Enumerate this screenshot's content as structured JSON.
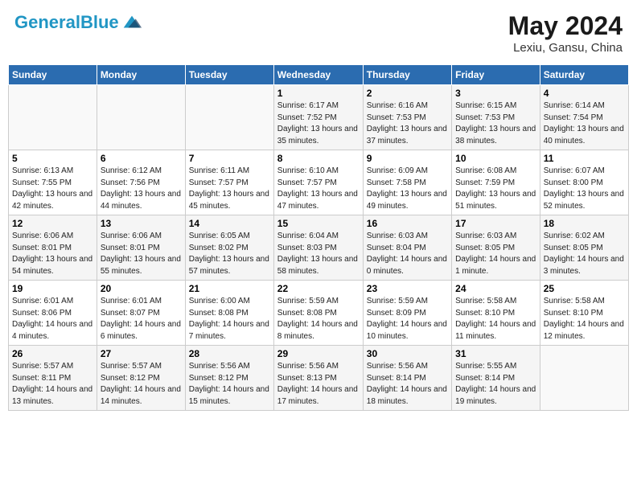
{
  "header": {
    "logo_text_general": "General",
    "logo_text_blue": "Blue",
    "month_year": "May 2024",
    "location": "Lexiu, Gansu, China"
  },
  "days_of_week": [
    "Sunday",
    "Monday",
    "Tuesday",
    "Wednesday",
    "Thursday",
    "Friday",
    "Saturday"
  ],
  "weeks": [
    [
      {
        "day": "",
        "sunrise": "",
        "sunset": "",
        "daylight": ""
      },
      {
        "day": "",
        "sunrise": "",
        "sunset": "",
        "daylight": ""
      },
      {
        "day": "",
        "sunrise": "",
        "sunset": "",
        "daylight": ""
      },
      {
        "day": "1",
        "sunrise": "Sunrise: 6:17 AM",
        "sunset": "Sunset: 7:52 PM",
        "daylight": "Daylight: 13 hours and 35 minutes."
      },
      {
        "day": "2",
        "sunrise": "Sunrise: 6:16 AM",
        "sunset": "Sunset: 7:53 PM",
        "daylight": "Daylight: 13 hours and 37 minutes."
      },
      {
        "day": "3",
        "sunrise": "Sunrise: 6:15 AM",
        "sunset": "Sunset: 7:53 PM",
        "daylight": "Daylight: 13 hours and 38 minutes."
      },
      {
        "day": "4",
        "sunrise": "Sunrise: 6:14 AM",
        "sunset": "Sunset: 7:54 PM",
        "daylight": "Daylight: 13 hours and 40 minutes."
      }
    ],
    [
      {
        "day": "5",
        "sunrise": "Sunrise: 6:13 AM",
        "sunset": "Sunset: 7:55 PM",
        "daylight": "Daylight: 13 hours and 42 minutes."
      },
      {
        "day": "6",
        "sunrise": "Sunrise: 6:12 AM",
        "sunset": "Sunset: 7:56 PM",
        "daylight": "Daylight: 13 hours and 44 minutes."
      },
      {
        "day": "7",
        "sunrise": "Sunrise: 6:11 AM",
        "sunset": "Sunset: 7:57 PM",
        "daylight": "Daylight: 13 hours and 45 minutes."
      },
      {
        "day": "8",
        "sunrise": "Sunrise: 6:10 AM",
        "sunset": "Sunset: 7:57 PM",
        "daylight": "Daylight: 13 hours and 47 minutes."
      },
      {
        "day": "9",
        "sunrise": "Sunrise: 6:09 AM",
        "sunset": "Sunset: 7:58 PM",
        "daylight": "Daylight: 13 hours and 49 minutes."
      },
      {
        "day": "10",
        "sunrise": "Sunrise: 6:08 AM",
        "sunset": "Sunset: 7:59 PM",
        "daylight": "Daylight: 13 hours and 51 minutes."
      },
      {
        "day": "11",
        "sunrise": "Sunrise: 6:07 AM",
        "sunset": "Sunset: 8:00 PM",
        "daylight": "Daylight: 13 hours and 52 minutes."
      }
    ],
    [
      {
        "day": "12",
        "sunrise": "Sunrise: 6:06 AM",
        "sunset": "Sunset: 8:01 PM",
        "daylight": "Daylight: 13 hours and 54 minutes."
      },
      {
        "day": "13",
        "sunrise": "Sunrise: 6:06 AM",
        "sunset": "Sunset: 8:01 PM",
        "daylight": "Daylight: 13 hours and 55 minutes."
      },
      {
        "day": "14",
        "sunrise": "Sunrise: 6:05 AM",
        "sunset": "Sunset: 8:02 PM",
        "daylight": "Daylight: 13 hours and 57 minutes."
      },
      {
        "day": "15",
        "sunrise": "Sunrise: 6:04 AM",
        "sunset": "Sunset: 8:03 PM",
        "daylight": "Daylight: 13 hours and 58 minutes."
      },
      {
        "day": "16",
        "sunrise": "Sunrise: 6:03 AM",
        "sunset": "Sunset: 8:04 PM",
        "daylight": "Daylight: 14 hours and 0 minutes."
      },
      {
        "day": "17",
        "sunrise": "Sunrise: 6:03 AM",
        "sunset": "Sunset: 8:05 PM",
        "daylight": "Daylight: 14 hours and 1 minute."
      },
      {
        "day": "18",
        "sunrise": "Sunrise: 6:02 AM",
        "sunset": "Sunset: 8:05 PM",
        "daylight": "Daylight: 14 hours and 3 minutes."
      }
    ],
    [
      {
        "day": "19",
        "sunrise": "Sunrise: 6:01 AM",
        "sunset": "Sunset: 8:06 PM",
        "daylight": "Daylight: 14 hours and 4 minutes."
      },
      {
        "day": "20",
        "sunrise": "Sunrise: 6:01 AM",
        "sunset": "Sunset: 8:07 PM",
        "daylight": "Daylight: 14 hours and 6 minutes."
      },
      {
        "day": "21",
        "sunrise": "Sunrise: 6:00 AM",
        "sunset": "Sunset: 8:08 PM",
        "daylight": "Daylight: 14 hours and 7 minutes."
      },
      {
        "day": "22",
        "sunrise": "Sunrise: 5:59 AM",
        "sunset": "Sunset: 8:08 PM",
        "daylight": "Daylight: 14 hours and 8 minutes."
      },
      {
        "day": "23",
        "sunrise": "Sunrise: 5:59 AM",
        "sunset": "Sunset: 8:09 PM",
        "daylight": "Daylight: 14 hours and 10 minutes."
      },
      {
        "day": "24",
        "sunrise": "Sunrise: 5:58 AM",
        "sunset": "Sunset: 8:10 PM",
        "daylight": "Daylight: 14 hours and 11 minutes."
      },
      {
        "day": "25",
        "sunrise": "Sunrise: 5:58 AM",
        "sunset": "Sunset: 8:10 PM",
        "daylight": "Daylight: 14 hours and 12 minutes."
      }
    ],
    [
      {
        "day": "26",
        "sunrise": "Sunrise: 5:57 AM",
        "sunset": "Sunset: 8:11 PM",
        "daylight": "Daylight: 14 hours and 13 minutes."
      },
      {
        "day": "27",
        "sunrise": "Sunrise: 5:57 AM",
        "sunset": "Sunset: 8:12 PM",
        "daylight": "Daylight: 14 hours and 14 minutes."
      },
      {
        "day": "28",
        "sunrise": "Sunrise: 5:56 AM",
        "sunset": "Sunset: 8:12 PM",
        "daylight": "Daylight: 14 hours and 15 minutes."
      },
      {
        "day": "29",
        "sunrise": "Sunrise: 5:56 AM",
        "sunset": "Sunset: 8:13 PM",
        "daylight": "Daylight: 14 hours and 17 minutes."
      },
      {
        "day": "30",
        "sunrise": "Sunrise: 5:56 AM",
        "sunset": "Sunset: 8:14 PM",
        "daylight": "Daylight: 14 hours and 18 minutes."
      },
      {
        "day": "31",
        "sunrise": "Sunrise: 5:55 AM",
        "sunset": "Sunset: 8:14 PM",
        "daylight": "Daylight: 14 hours and 19 minutes."
      },
      {
        "day": "",
        "sunrise": "",
        "sunset": "",
        "daylight": ""
      }
    ]
  ]
}
